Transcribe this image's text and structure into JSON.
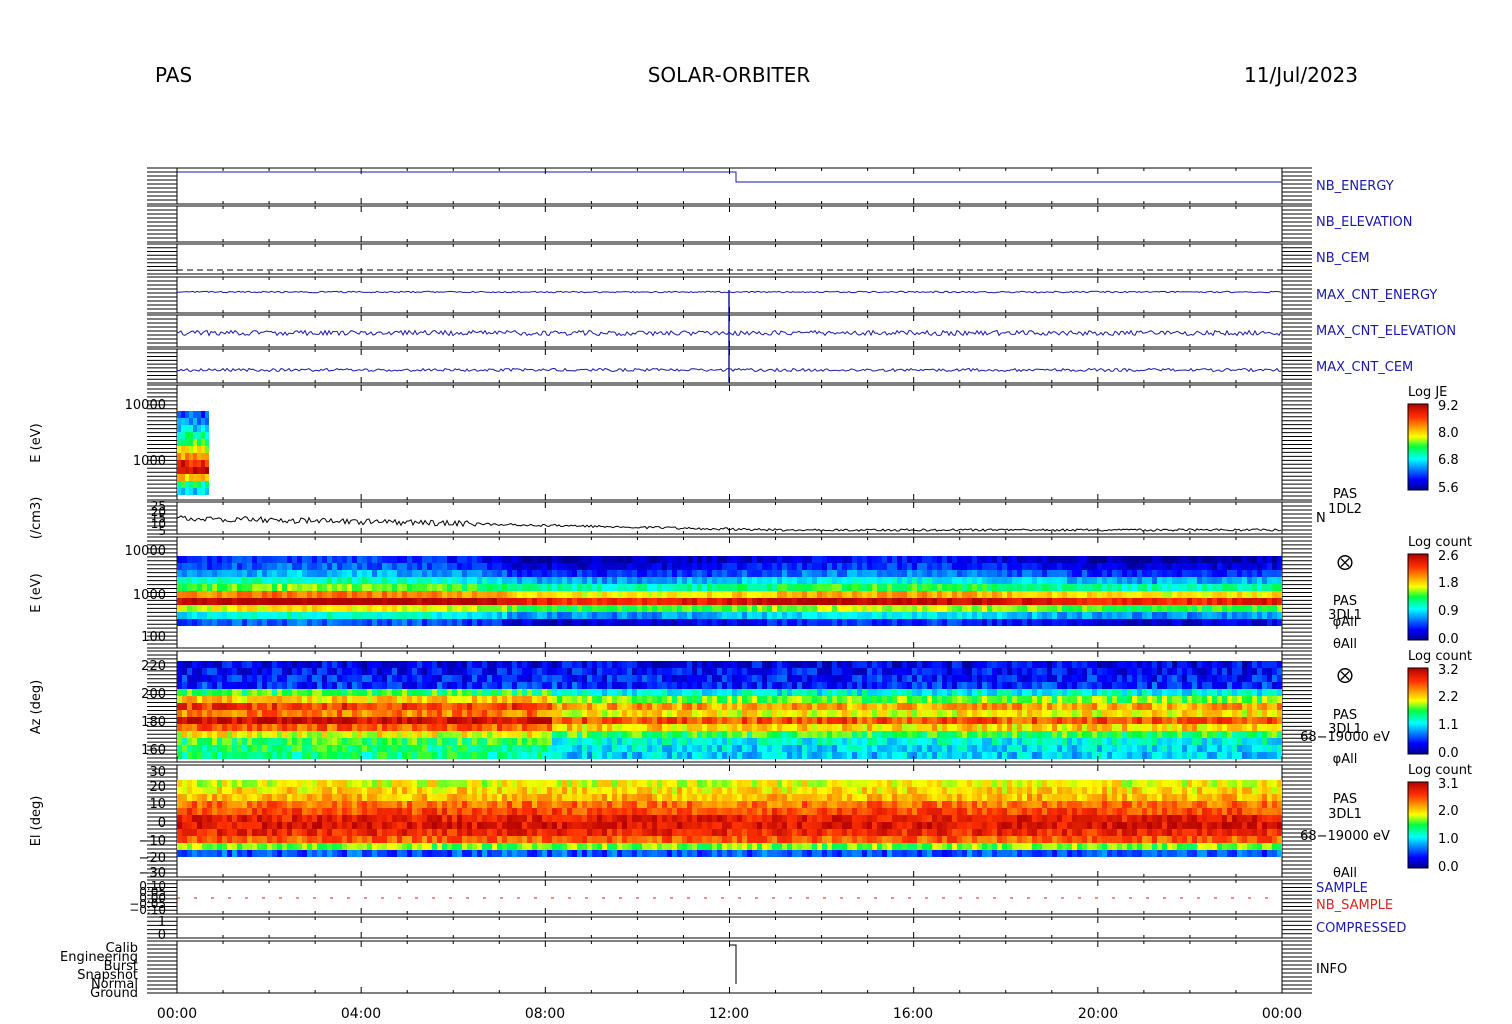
{
  "header": {
    "instrument": "PAS",
    "mission": "SOLAR-ORBITER",
    "date": "11/Jul/2023"
  },
  "time_axis": {
    "ticks": [
      "00:00",
      "04:00",
      "08:00",
      "12:00",
      "16:00",
      "20:00",
      "00:00"
    ]
  },
  "panels": {
    "nb_energy": {
      "label": "NB_ENERGY",
      "color": "#1a1aa8"
    },
    "nb_elevation": {
      "label": "NB_ELEVATION",
      "color": "#1a1aa8"
    },
    "nb_cem": {
      "label": "NB_CEM",
      "color": "#1a1aa8"
    },
    "max_cnt_energy": {
      "label": "MAX_CNT_ENERGY",
      "color": "#1a1aa8"
    },
    "max_cnt_elevation": {
      "label": "MAX_CNT_ELEVATION",
      "color": "#1a1aa8"
    },
    "max_cnt_cem": {
      "label": "MAX_CNT_CEM",
      "color": "#1a1aa8"
    },
    "spec1": {
      "ylabel": "E (eV)",
      "yticks": [
        "10000",
        "1000"
      ],
      "cbar_title": "Log JE",
      "cbar_ticks": [
        "9.2",
        "8.0",
        "6.8",
        "5.6"
      ]
    },
    "density": {
      "ylabel": "(/cm3)",
      "yticks": [
        "25",
        "20",
        "15",
        "10",
        "5"
      ],
      "side_labels": [
        "PAS",
        "1DL2",
        "N"
      ]
    },
    "spec2": {
      "ylabel": "E (eV)",
      "yticks": [
        "10000",
        "1000",
        "100"
      ],
      "cbar_title": "Log count",
      "cbar_ticks": [
        "2.6",
        "1.8",
        "0.9",
        "0.0"
      ],
      "side_labels": [
        "⨂",
        "PAS",
        "3DL1",
        "φAll",
        "θAll"
      ]
    },
    "azimuth": {
      "ylabel": "Az (deg)",
      "yticks": [
        "220",
        "200",
        "180",
        "160"
      ],
      "cbar_title": "Log count",
      "cbar_ticks": [
        "3.2",
        "2.2",
        "1.1",
        "0.0"
      ],
      "side_labels": [
        "⨂",
        "PAS",
        "3DL1",
        "68−19000 eV",
        "φAll"
      ]
    },
    "elevation": {
      "ylabel": "El (deg)",
      "yticks": [
        "30",
        "20",
        "10",
        "0",
        "−10",
        "−20",
        "−30"
      ],
      "cbar_title": "Log count",
      "cbar_ticks": [
        "3.1",
        "2.0",
        "1.0",
        "0.0"
      ],
      "side_labels": [
        "PAS",
        "3DL1",
        "68−19000 eV",
        "θAll"
      ]
    },
    "sample": {
      "labels": [
        "SAMPLE",
        "NB_SAMPLE"
      ],
      "colors": [
        "#1a1aa8",
        "#e02020"
      ],
      "yticks": [
        "0.10",
        "0.05",
        "0.00",
        "−0.05",
        "−0.10"
      ]
    },
    "compressed": {
      "label": "COMPRESSED",
      "color": "#1a1aa8",
      "yticks": [
        "1",
        "0"
      ]
    },
    "info": {
      "label": "INFO",
      "yticks": [
        "Calib",
        "Engineering",
        "Burst",
        "Snapshot",
        "Normal",
        "Ground"
      ]
    }
  },
  "colors": {
    "axis": "#000000",
    "trace": "#1a1aa8",
    "nb_sample": "#e02020"
  },
  "chart_data": {
    "type": "heatmap",
    "x_range": [
      "00:00",
      "24:00"
    ],
    "series": [
      {
        "name": "Log JE",
        "y_range_eV": [
          300,
          10000
        ],
        "z_range": [
          5.6,
          9.2
        ]
      },
      {
        "name": "N",
        "y_range": [
          5,
          25
        ]
      },
      {
        "name": "Log count",
        "y_range_eV": [
          100,
          10000
        ],
        "z_range": [
          0.0,
          2.6
        ]
      },
      {
        "name": "Log count",
        "y_range_deg": [
          150,
          230
        ],
        "z_range": [
          0.0,
          3.2
        ]
      },
      {
        "name": "Log count",
        "y_range_deg": [
          -30,
          30
        ],
        "z_range": [
          0.0,
          3.1
        ]
      }
    ]
  }
}
